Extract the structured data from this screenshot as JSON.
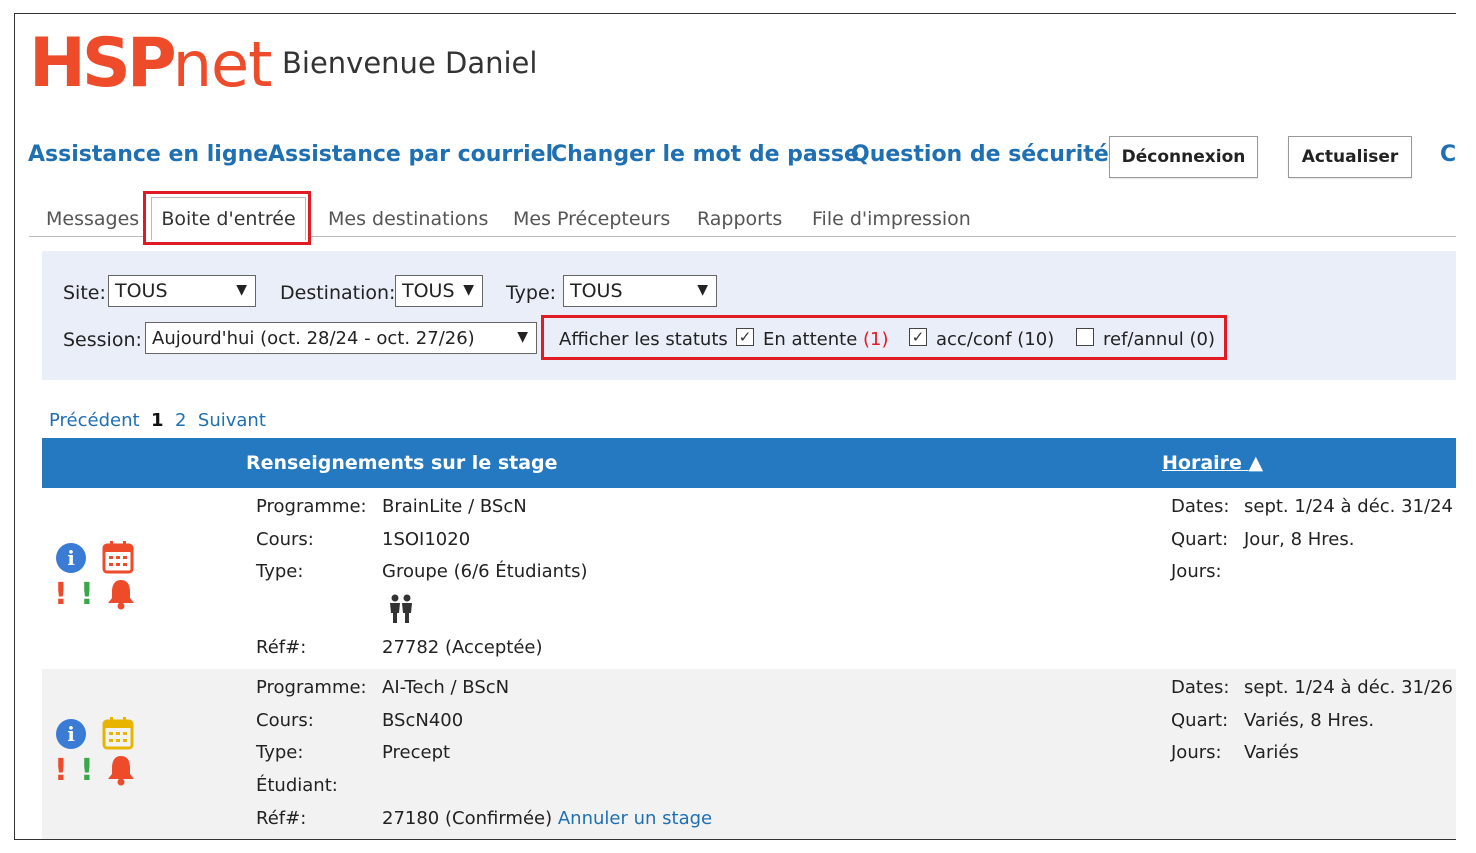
{
  "brand": {
    "logo_main": "HSP",
    "logo_tail": "net",
    "color": "#ee4b2b"
  },
  "welcome": "Bienvenue Daniel",
  "toplinks": [
    "Assistance en ligne",
    "Assistance par courriel",
    "Changer le mot de passe",
    "Question de sécurité"
  ],
  "buttons": {
    "logout": "Déconnexion",
    "refresh": "Actualiser",
    "overflow": "C"
  },
  "tabs": {
    "messages": "Messages",
    "inbox": "Boite d'entrée",
    "destinations": "Mes destinations",
    "preceptors": "Mes Précepteurs",
    "reports": "Rapports",
    "print": "File d'impression"
  },
  "filters": {
    "site_label": "Site:",
    "site_value": "TOUS",
    "destination_label": "Destination:",
    "destination_value": "TOUS",
    "type_label": "Type:",
    "type_value": "TOUS",
    "session_label": "Session:",
    "session_value": "Aujourd'hui (oct. 28/24 - oct. 27/26)",
    "status_label": "Afficher les statuts",
    "statuses": [
      {
        "label": "En attente",
        "count": "(1)",
        "checked": true
      },
      {
        "label": "acc/conf",
        "count": "(10)",
        "checked": true
      },
      {
        "label": "ref/annul",
        "count": "(0)",
        "checked": false
      }
    ]
  },
  "pager": {
    "prev": "Précédent",
    "current": "1",
    "next_page": "2",
    "next": "Suivant"
  },
  "table": {
    "col_info": "Renseignements sur le stage",
    "col_schedule": "Horaire"
  },
  "labels": {
    "program": "Programme:",
    "course": "Cours:",
    "type": "Type:",
    "student": "Étudiant:",
    "ref": "Réf#:",
    "dates": "Dates:",
    "shift": "Quart:",
    "days": "Jours:"
  },
  "rows": [
    {
      "program": "BrainLite / BScN",
      "course": "1SOI1020",
      "type": "Groupe (6/6 Étudiants)",
      "ref": "27782 (Acceptée)",
      "dates": "sept. 1/24 à déc. 31/24",
      "shift": "Jour, 8 Hres.",
      "days": "",
      "calendar_color": "#ee4b2b"
    },
    {
      "program": "AI-Tech / BScN",
      "course": "BScN400",
      "type": "Precept",
      "student": "",
      "ref": "27180 (Confirmée)",
      "cancel": "Annuler un stage",
      "dates": "sept. 1/24 à déc. 31/26",
      "shift": "Variés, 8 Hres.",
      "days": "Variés",
      "calendar_color": "#e8b400"
    }
  ]
}
